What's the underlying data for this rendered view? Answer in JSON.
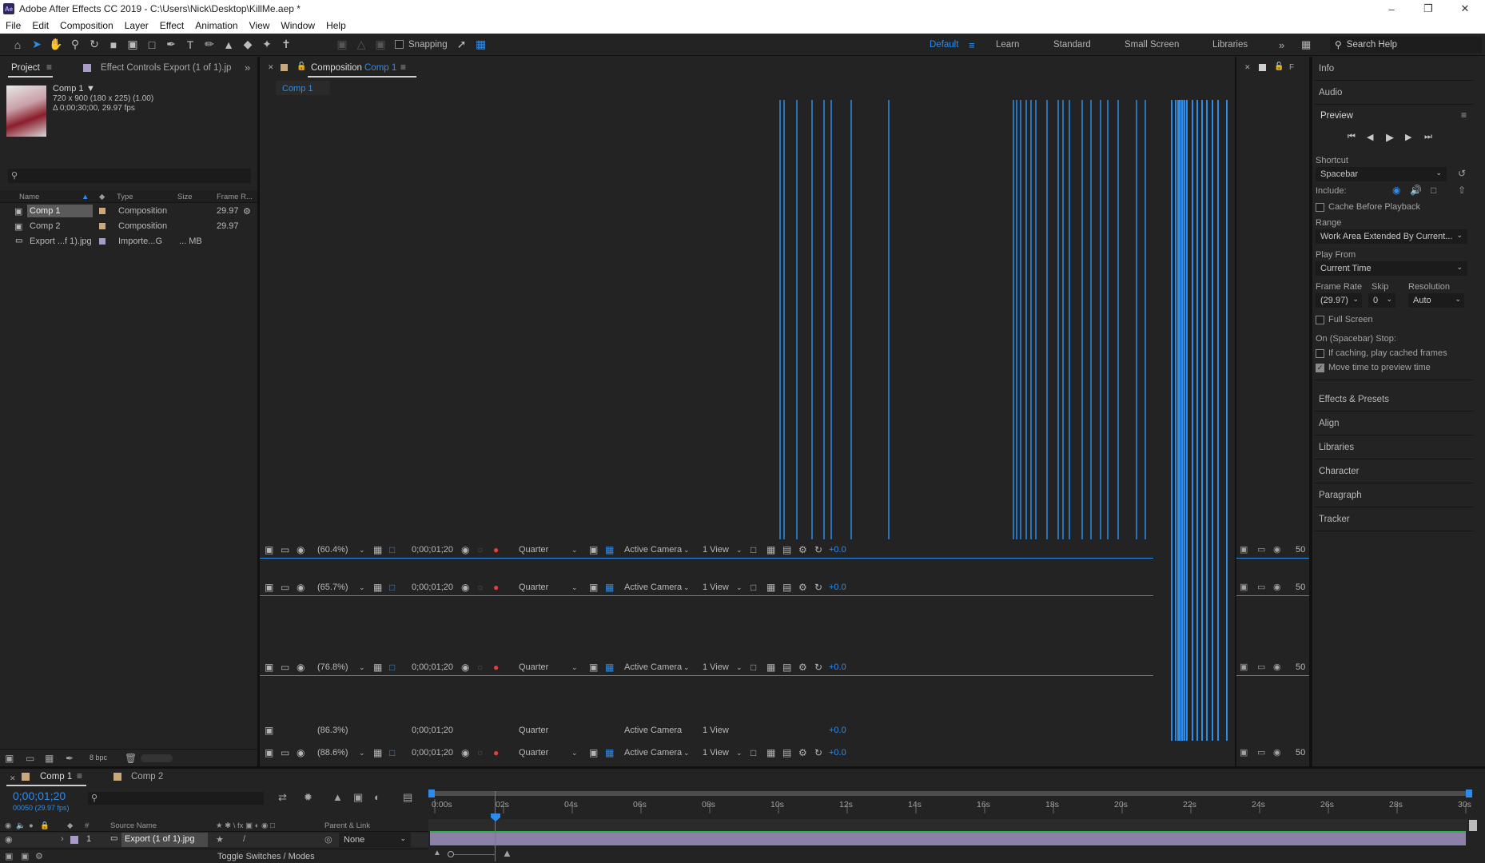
{
  "window": {
    "app_icon": "Ae",
    "title": "Adobe After Effects CC 2019 - C:\\Users\\Nick\\Desktop\\KillMe.aep *"
  },
  "menu": [
    "File",
    "Edit",
    "Composition",
    "Layer",
    "Effect",
    "Animation",
    "View",
    "Window",
    "Help"
  ],
  "toolbar": {
    "snapping_label": "Snapping",
    "workspaces": [
      "Default",
      "Learn",
      "Standard",
      "Small Screen",
      "Libraries"
    ],
    "active_workspace": "Default",
    "search_placeholder": "Search Help"
  },
  "project": {
    "tab_label": "Project",
    "effect_controls_label": "Effect Controls Export (1 of 1).jp",
    "item_name": "Comp 1",
    "item_dims": "720 x 900  (180 x 225) (1.00)",
    "item_duration": "Δ 0;00;30;00, 29.97 fps",
    "columns": [
      "Name",
      "Type",
      "Size",
      "Frame R..."
    ],
    "items": [
      {
        "name": "Comp 1",
        "type": "Composition",
        "size": "",
        "frame_rate": "29.97",
        "swatch": "#c9a87c",
        "selected": true
      },
      {
        "name": "Comp 2",
        "type": "Composition",
        "size": "",
        "frame_rate": "29.97",
        "swatch": "#c9a87c",
        "selected": false
      },
      {
        "name": "Export ...f 1).jpg",
        "type": "Importe...G",
        "size": "... MB",
        "frame_rate": "",
        "swatch": "#a99ac8",
        "selected": false
      }
    ],
    "bpc_label": "8 bpc"
  },
  "composition": {
    "panel_label": "Composition",
    "panel_name": "Comp 1",
    "breadcrumb": "Comp 1",
    "viewer_bars": [
      {
        "zoom": "(60.4%)",
        "timecode": "0;00;01;20",
        "resolution": "Quarter",
        "camera": "Active Camera",
        "views": "1 View",
        "exposure": "+0.0"
      },
      {
        "zoom": "(65.7%)",
        "timecode": "0;00;01;20",
        "resolution": "Quarter",
        "camera": "Active Camera",
        "views": "1 View",
        "exposure": "+0.0"
      },
      {
        "zoom": "(76.8%)",
        "timecode": "0;00;01;20",
        "resolution": "Quarter",
        "camera": "Active Camera",
        "views": "1 View",
        "exposure": "+0.0"
      },
      {
        "zoom": "(86.3%)",
        "timecode": "0;00;01;20",
        "resolution": "Quarter",
        "camera": "Active Camera",
        "views": "1 View",
        "exposure": "+0.0"
      },
      {
        "zoom": "(88.6%)",
        "timecode": "0;00;01;20",
        "resolution": "Quarter",
        "camera": "Active Camera",
        "views": "1 View",
        "exposure": "+0.0"
      }
    ],
    "side_zoom": "50",
    "side_tab": "F"
  },
  "right_panel": {
    "info_label": "Info",
    "audio_label": "Audio",
    "preview_label": "Preview",
    "shortcut_label": "Shortcut",
    "shortcut_value": "Spacebar",
    "include_label": "Include:",
    "cache_label": "Cache Before Playback",
    "range_label": "Range",
    "range_value": "Work Area Extended By Current...",
    "play_from_label": "Play From",
    "play_from_value": "Current Time",
    "frame_rate_label": "Frame Rate",
    "frame_rate_value": "(29.97)",
    "skip_label": "Skip",
    "skip_value": "0",
    "resolution_label": "Resolution",
    "resolution_value": "Auto",
    "full_screen_label": "Full Screen",
    "on_stop_label": "On (Spacebar) Stop:",
    "if_caching_label": "If caching, play cached frames",
    "move_time_label": "Move time to preview time",
    "panels": [
      "Effects & Presets",
      "Align",
      "Libraries",
      "Character",
      "Paragraph",
      "Tracker"
    ]
  },
  "timeline": {
    "tabs": [
      "Comp 1",
      "Comp 2"
    ],
    "current_time": "0;00;01;20",
    "frame_info": "00050 (29.97 fps)",
    "col_source": "Source Name",
    "col_parent": "Parent & Link",
    "layer": {
      "index": "1",
      "name": "Export (1 of 1).jpg",
      "parent": "None"
    },
    "ticks": [
      "0:00s",
      "02s",
      "04s",
      "06s",
      "08s",
      "10s",
      "12s",
      "14s",
      "16s",
      "18s",
      "20s",
      "22s",
      "24s",
      "26s",
      "28s",
      "30s"
    ],
    "toggle_label": "Toggle Switches / Modes"
  },
  "colors": {
    "accent": "#2d8ceb",
    "panel": "#232323",
    "layer_bar": "#8c7fa8"
  }
}
